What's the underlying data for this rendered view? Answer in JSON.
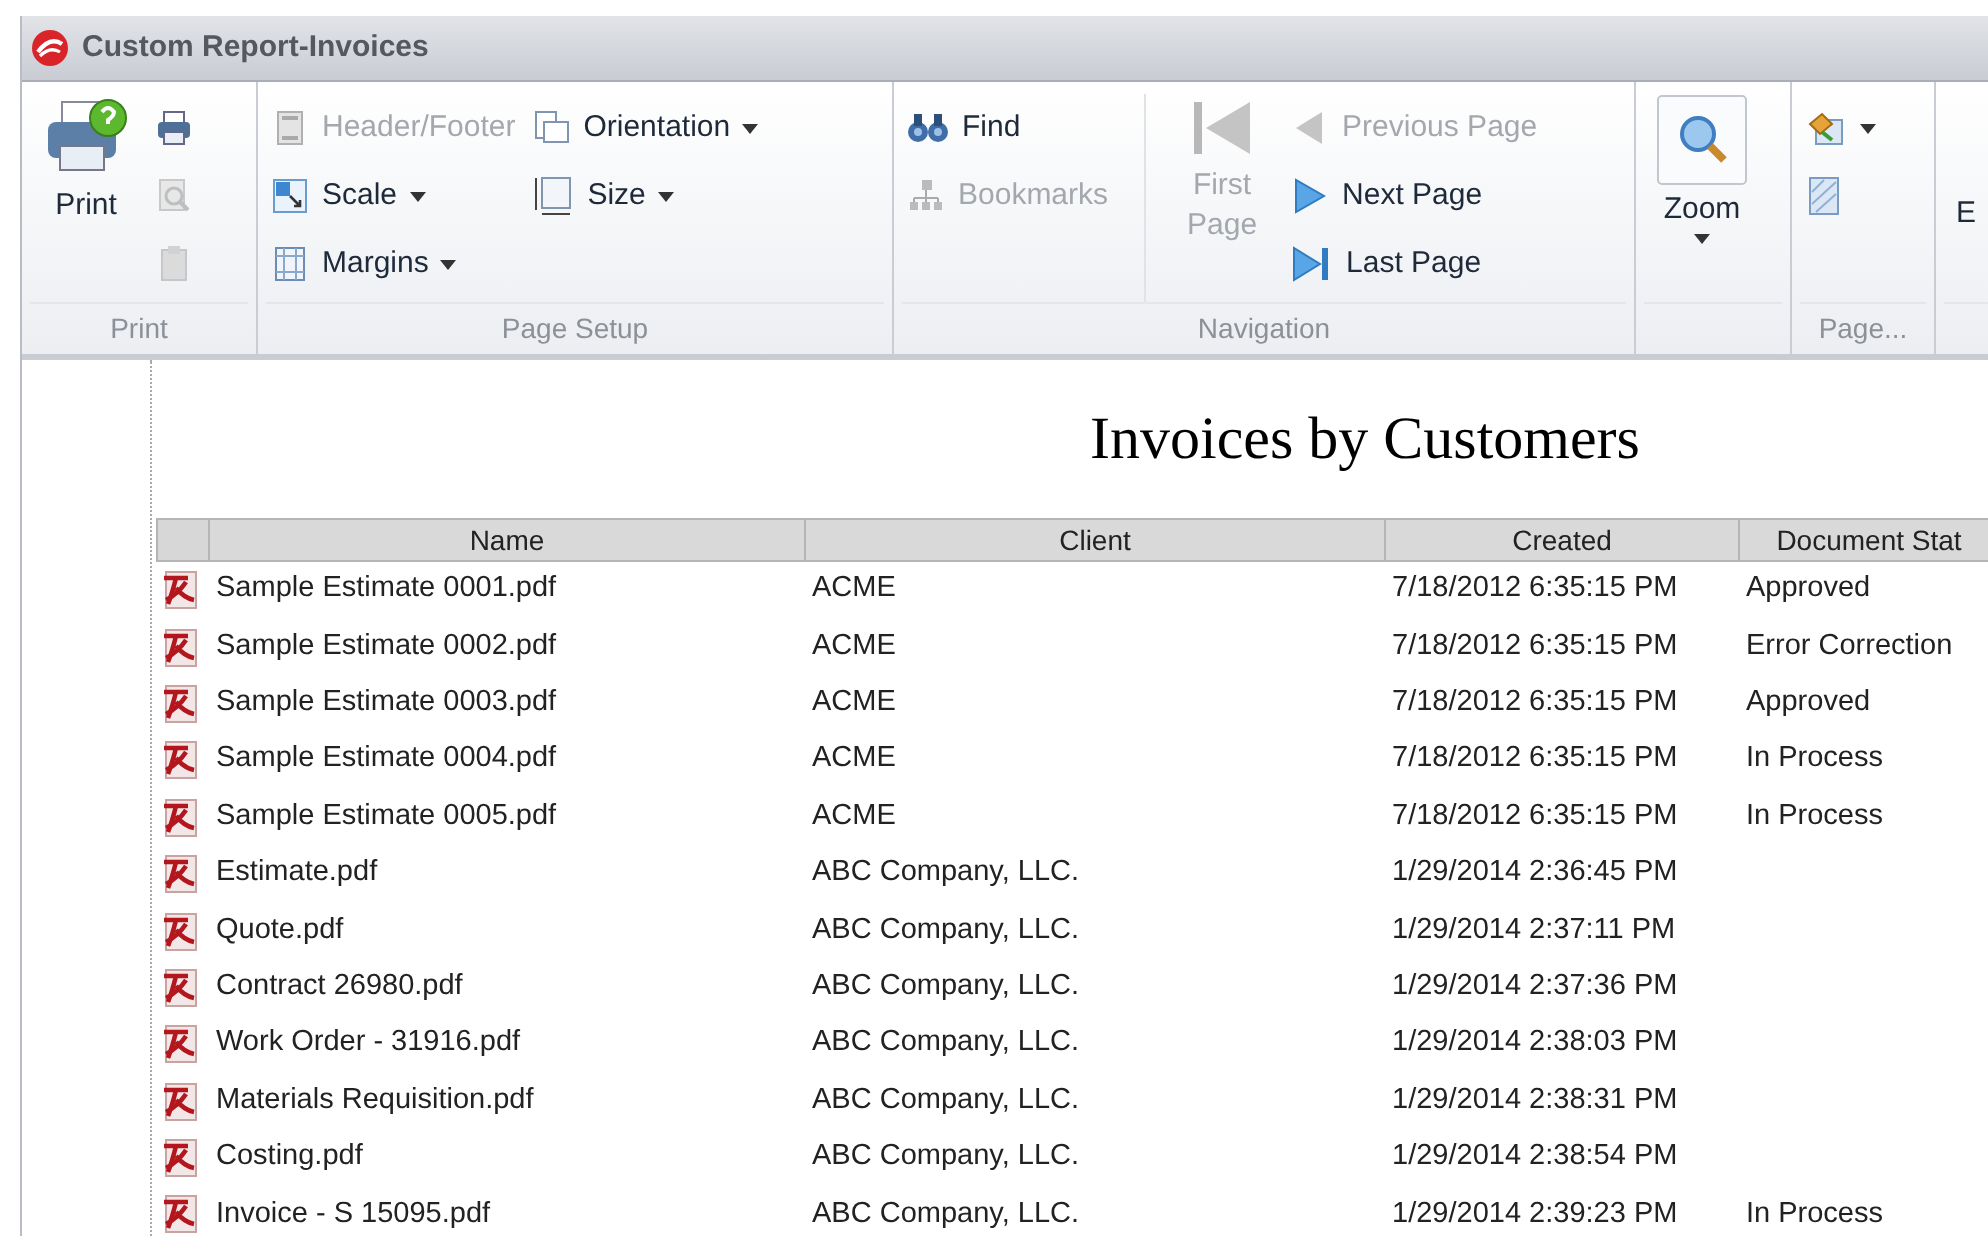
{
  "window": {
    "title": "Custom Report-Invoices"
  },
  "ribbon": {
    "groups": [
      {
        "label": "Print",
        "columns": [
          [
            {
              "kind": "large",
              "label": "Print",
              "disabled": false
            }
          ],
          [
            {
              "kind": "small",
              "disabled": false
            },
            {
              "kind": "small",
              "disabled": true
            },
            {
              "kind": "small",
              "disabled": true
            }
          ]
        ]
      },
      {
        "label": "Page Setup",
        "columns": [
          [
            {
              "kind": "small",
              "label": "Header/Footer",
              "disabled": true,
              "dropdown": false
            },
            {
              "kind": "small",
              "label": "Scale",
              "disabled": false,
              "dropdown": true
            },
            {
              "kind": "small",
              "label": "Margins",
              "disabled": false,
              "dropdown": true
            }
          ],
          [
            {
              "kind": "small",
              "label": "Orientation",
              "disabled": false,
              "dropdown": true
            },
            {
              "kind": "small",
              "label": "Size",
              "disabled": false,
              "dropdown": true
            }
          ]
        ]
      },
      {
        "label": "Navigation",
        "columns": [
          [
            {
              "kind": "small",
              "label": "Find",
              "disabled": false
            },
            {
              "kind": "small",
              "label": "Bookmarks",
              "disabled": true
            }
          ],
          [
            {
              "kind": "large",
              "label": "First Page",
              "disabled": true
            }
          ],
          [
            {
              "kind": "small",
              "label": "Previous Page",
              "disabled": true
            },
            {
              "kind": "small",
              "label": "Next Page",
              "disabled": false
            },
            {
              "kind": "small",
              "label": "Last Page",
              "disabled": false
            }
          ]
        ]
      },
      {
        "columns": [
          [
            {
              "kind": "large",
              "label": "Zoom",
              "disabled": false,
              "dropdown": true
            }
          ]
        ]
      },
      {
        "label": "Page...",
        "columns": [
          [
            {
              "kind": "small",
              "disabled": false,
              "dropdown": true
            },
            {
              "kind": "small",
              "disabled": false
            }
          ]
        ]
      },
      {
        "columns": [
          [
            {
              "kind": "large",
              "label": "E",
              "disabled": false
            }
          ]
        ]
      }
    ]
  },
  "report": {
    "title": "Invoices by Customers",
    "columns": [
      "Name",
      "Client",
      "Created",
      "Document Stat"
    ],
    "rows": [
      {
        "name": "Sample Estimate 0001.pdf",
        "client": "ACME",
        "created": "7/18/2012 6:35:15 PM",
        "status": "Approved"
      },
      {
        "name": "Sample Estimate 0002.pdf",
        "client": "ACME",
        "created": "7/18/2012 6:35:15 PM",
        "status": "Error Correction"
      },
      {
        "name": "Sample Estimate 0003.pdf",
        "client": "ACME",
        "created": "7/18/2012 6:35:15 PM",
        "status": "Approved"
      },
      {
        "name": "Sample Estimate 0004.pdf",
        "client": "ACME",
        "created": "7/18/2012 6:35:15 PM",
        "status": "In Process"
      },
      {
        "name": "Sample Estimate 0005.pdf",
        "client": "ACME",
        "created": "7/18/2012 6:35:15 PM",
        "status": "In Process"
      },
      {
        "name": "Estimate.pdf",
        "client": "ABC Company, LLC.",
        "created": "1/29/2014 2:36:45 PM"
      },
      {
        "name": "Quote.pdf",
        "client": "ABC Company, LLC.",
        "created": "1/29/2014 2:37:11 PM"
      },
      {
        "name": "Contract 26980.pdf",
        "client": "ABC Company, LLC.",
        "created": "1/29/2014 2:37:36 PM"
      },
      {
        "name": "Work Order - 31916.pdf",
        "client": "ABC Company, LLC.",
        "created": "1/29/2014 2:38:03 PM"
      },
      {
        "name": "Materials Requisition.pdf",
        "client": "ABC Company, LLC.",
        "created": "1/29/2014 2:38:31 PM"
      },
      {
        "name": "Costing.pdf",
        "client": "ABC Company, LLC.",
        "created": "1/29/2014 2:38:54 PM"
      },
      {
        "name": "Invoice - S 15095.pdf",
        "client": "ABC Company, LLC.",
        "created": "1/29/2014 2:39:23 PM",
        "status": "In Process"
      }
    ]
  }
}
